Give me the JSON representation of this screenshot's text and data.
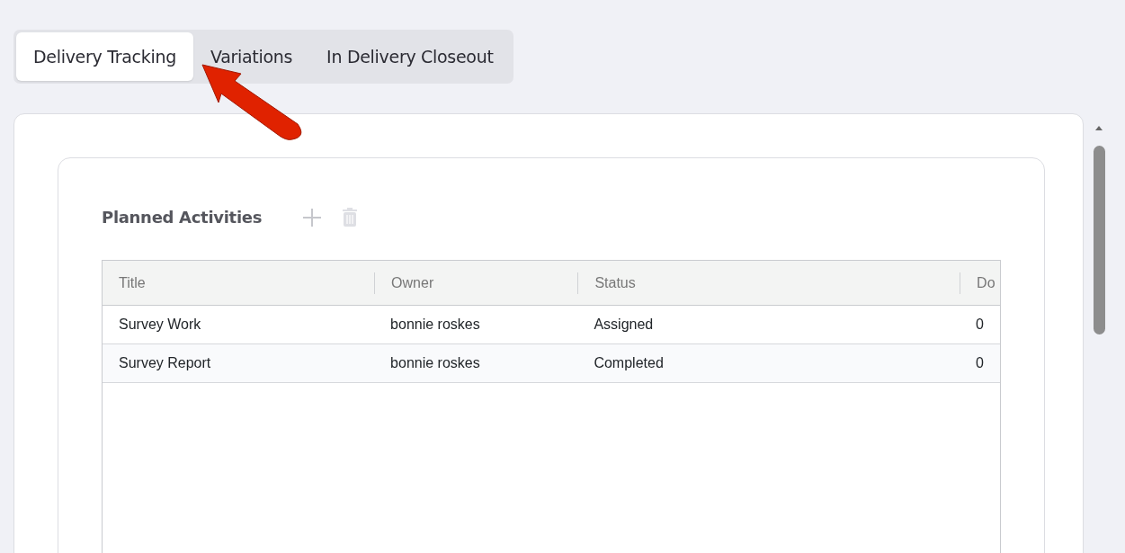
{
  "tabs": [
    {
      "label": "Delivery Tracking",
      "selected": true
    },
    {
      "label": "Variations",
      "selected": false
    },
    {
      "label": "In Delivery Closeout",
      "selected": false
    }
  ],
  "section": {
    "title": "Planned Activities"
  },
  "table": {
    "columns": [
      "Title",
      "Owner",
      "Status",
      "Do"
    ],
    "rows": [
      {
        "cells": [
          "Survey Work",
          "bonnie roskes",
          "Assigned",
          "0"
        ],
        "selected": false
      },
      {
        "cells": [
          "Survey Report",
          "bonnie roskes",
          "Completed",
          "0"
        ],
        "selected": false
      }
    ]
  }
}
